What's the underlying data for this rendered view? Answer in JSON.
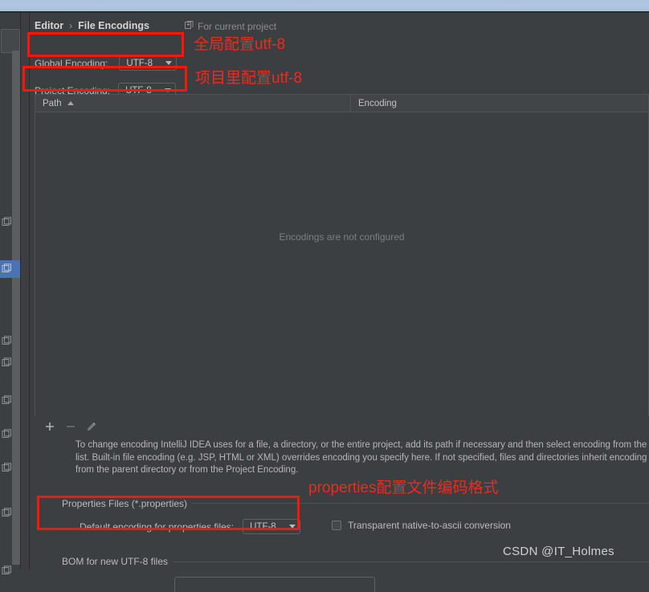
{
  "window": {
    "top_strip_color": "#aec4de",
    "panel_bg": "#3c3f41"
  },
  "sidebar": {
    "selected_index": 1,
    "selected_color": "#4a72b5",
    "items": [
      {
        "icon": "module-icon"
      },
      {
        "icon": "module-icon"
      },
      {
        "icon": "module-icon"
      },
      {
        "icon": "module-icon"
      },
      {
        "icon": "module-icon"
      },
      {
        "icon": "module-icon"
      },
      {
        "icon": "module-icon"
      },
      {
        "icon": "module-icon"
      },
      {
        "icon": "module-icon"
      }
    ]
  },
  "breadcrumb": {
    "parent": "Editor",
    "separator": "›",
    "current": "File Encodings"
  },
  "scope": {
    "icon": "project-scope-icon",
    "label": "For current project"
  },
  "encodings": {
    "global": {
      "label": "Global Encoding:",
      "value": "UTF-8"
    },
    "project": {
      "label": "Project Encoding:",
      "value": "UTF-8"
    }
  },
  "table": {
    "columns": [
      {
        "label": "Path",
        "sort": "ascending"
      },
      {
        "label": "Encoding",
        "sort": "none"
      }
    ],
    "rows": [],
    "empty_message": "Encodings are not configured",
    "toolbar": [
      {
        "name": "add-button",
        "glyph": "+",
        "enabled": true
      },
      {
        "name": "remove-button",
        "glyph": "−",
        "enabled": false
      },
      {
        "name": "edit-button",
        "glyph": "pencil",
        "enabled": false
      }
    ]
  },
  "description": {
    "line1": "To change encoding IntelliJ IDEA uses for a file, a directory, or the entire project, add its path if necessary and then select encoding from the en",
    "line2": "list. Built-in file encoding (e.g. JSP, HTML or XML) overrides encoding you specify here. If not specified, files and directories inherit encoding se",
    "line3": "from the parent directory or from the Project Encoding."
  },
  "properties_group": {
    "title": "Properties Files (*.properties)",
    "default_encoding_label": "Default encoding for properties files:",
    "default_encoding_value": "UTF-8",
    "transparent_checkbox": {
      "label": "Transparent native-to-ascii conversion",
      "checked": false
    }
  },
  "bom_group": {
    "title": "BOM for new UTF-8 files",
    "value": ""
  },
  "annotations": {
    "color": "#ef2a1c",
    "global": "全局配置utf-8",
    "project": "项目里配置utf-8",
    "properties": "properties配置文件编码格式"
  },
  "watermark": "CSDN @IT_Holmes"
}
